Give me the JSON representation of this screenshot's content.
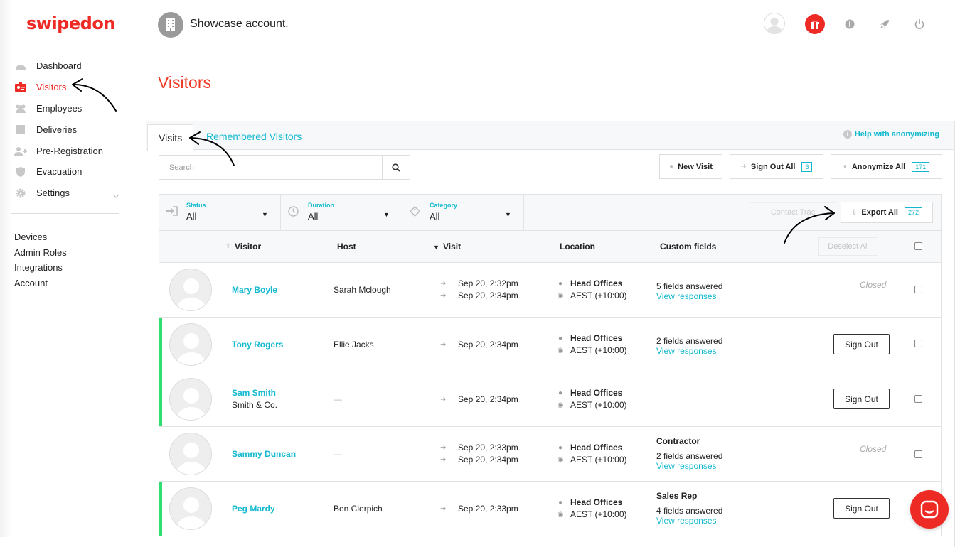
{
  "brand": {
    "logo_text": "swipedon",
    "accent": "#ee2a24",
    "link_color": "#14b9cf",
    "active_bar": "#2ee06f"
  },
  "sidebar": {
    "items": [
      {
        "label": "Dashboard",
        "icon": "dashboard-icon",
        "active": false
      },
      {
        "label": "Visitors",
        "icon": "visitor-badge-icon",
        "active": true
      },
      {
        "label": "Employees",
        "icon": "employees-icon",
        "active": false
      },
      {
        "label": "Deliveries",
        "icon": "deliveries-icon",
        "active": false
      },
      {
        "label": "Pre-Registration",
        "icon": "pre-registration-icon",
        "active": false
      },
      {
        "label": "Evacuation",
        "icon": "shield-icon",
        "active": false
      },
      {
        "label": "Settings",
        "icon": "gear-icon",
        "active": false
      }
    ],
    "secondary": [
      "Devices",
      "Admin Roles",
      "Integrations",
      "Account"
    ]
  },
  "header": {
    "account_name": "Showcase account."
  },
  "page": {
    "title": "Visitors"
  },
  "tabs": {
    "active": "Visits",
    "other": "Remembered Visitors",
    "help": "Help with anonymizing"
  },
  "toolbar": {
    "search_placeholder": "Search",
    "new_visit": "New Visit",
    "sign_out_all": "Sign Out All",
    "sign_out_all_count": "6",
    "anonymize_all": "Anonymize All",
    "anonymize_all_count": "171"
  },
  "filters": [
    {
      "label": "Status",
      "value": "All",
      "icon": "sign-in-icon"
    },
    {
      "label": "Duration",
      "value": "All",
      "icon": "clock-icon"
    },
    {
      "label": "Category",
      "value": "All",
      "icon": "tag-icon"
    }
  ],
  "actions": {
    "contact_trace": "Contact Trac",
    "export_all": "Export All",
    "export_count": "272"
  },
  "table": {
    "headers": {
      "visitor": "Visitor",
      "host": "Host",
      "visit": "Visit",
      "location": "Location",
      "custom_fields": "Custom fields",
      "deselect_all": "Deselect All"
    },
    "rows": [
      {
        "name": "Mary Boyle",
        "company": "",
        "host": "Sarah Mclough",
        "sign_in": "Sep 20, 2:32pm",
        "sign_out": "Sep 20, 2:34pm",
        "location": "Head Offices",
        "timezone": "AEST (+10:00)",
        "category": "",
        "fields": "5 fields answered",
        "view": "View responses",
        "status": "Closed",
        "active": false
      },
      {
        "name": "Tony Rogers",
        "company": "",
        "host": "Ellie Jacks",
        "sign_in": "Sep 20, 2:34pm",
        "sign_out": "",
        "location": "Head Offices",
        "timezone": "AEST (+10:00)",
        "category": "",
        "fields": "2 fields answered",
        "view": "View responses",
        "status": "Sign Out",
        "active": true
      },
      {
        "name": "Sam Smith",
        "company": "Smith & Co.",
        "host": "—",
        "sign_in": "Sep 20, 2:34pm",
        "sign_out": "",
        "location": "Head Offices",
        "timezone": "AEST (+10:00)",
        "category": "",
        "fields": "",
        "view": "",
        "status": "Sign Out",
        "active": true
      },
      {
        "name": "Sammy Duncan",
        "company": "",
        "host": "—",
        "sign_in": "Sep 20, 2:33pm",
        "sign_out": "Sep 20, 2:34pm",
        "location": "Head Offices",
        "timezone": "AEST (+10:00)",
        "category": "Contractor",
        "fields": "2 fields answered",
        "view": "View responses",
        "status": "Closed",
        "active": false
      },
      {
        "name": "Peg Mardy",
        "company": "",
        "host": "Ben Cierpich",
        "sign_in": "Sep 20, 2:33pm",
        "sign_out": "",
        "location": "Head Offices",
        "timezone": "AEST (+10:00)",
        "category": "Sales Rep",
        "fields": "4 fields answered",
        "view": "View responses",
        "status": "Sign Out",
        "active": true
      }
    ]
  }
}
